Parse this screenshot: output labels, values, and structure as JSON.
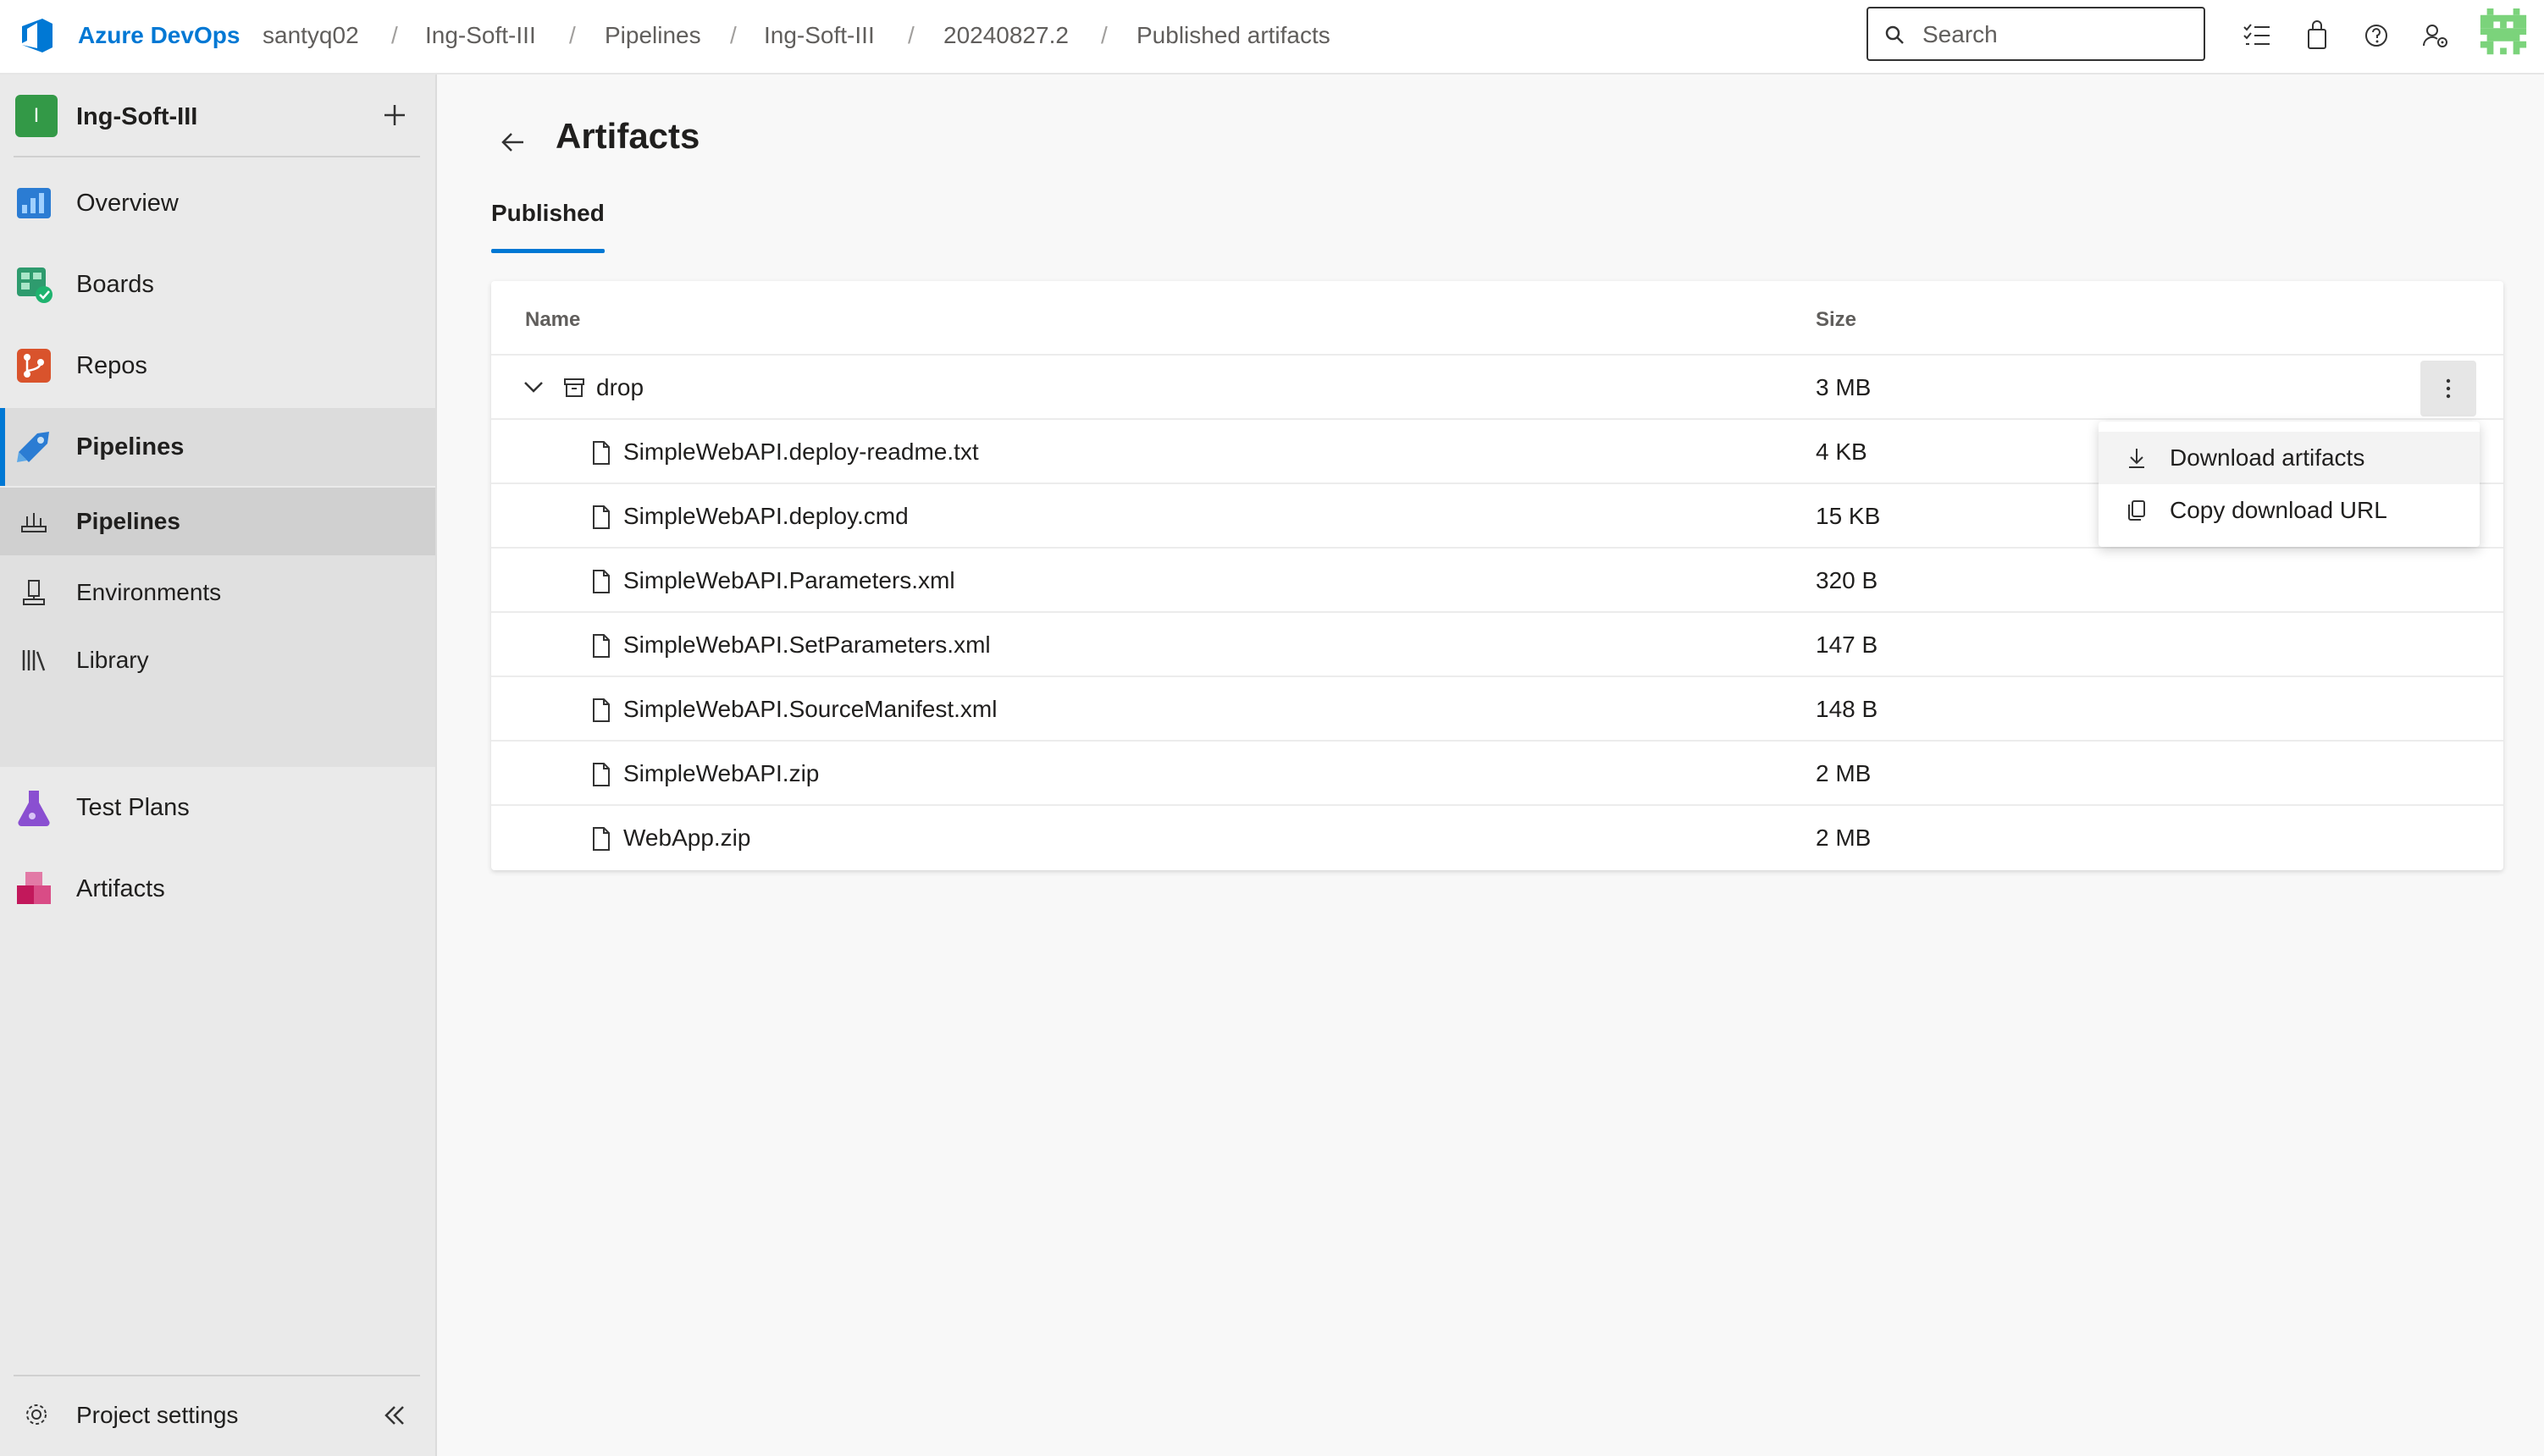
{
  "header": {
    "brand": "Azure DevOps",
    "breadcrumb": [
      "santyq02",
      "Ing-Soft-III",
      "Pipelines",
      "Ing-Soft-III",
      "20240827.2",
      "Published artifacts"
    ],
    "search_placeholder": "Search"
  },
  "sidebar": {
    "project_initial": "I",
    "project_name": "Ing-Soft-III",
    "items": [
      {
        "label": "Overview",
        "icon": "overview-icon"
      },
      {
        "label": "Boards",
        "icon": "boards-icon"
      },
      {
        "label": "Repos",
        "icon": "repos-icon"
      },
      {
        "label": "Pipelines",
        "icon": "pipelines-icon"
      },
      {
        "label": "Test Plans",
        "icon": "test-plans-icon"
      },
      {
        "label": "Artifacts",
        "icon": "artifacts-icon"
      }
    ],
    "pipelines_sub": [
      {
        "label": "Pipelines",
        "icon": "pipelines-sub-icon"
      },
      {
        "label": "Environments",
        "icon": "environments-icon"
      },
      {
        "label": "Library",
        "icon": "library-icon"
      }
    ],
    "settings_label": "Project settings"
  },
  "main": {
    "title": "Artifacts",
    "tab": "Published",
    "columns": {
      "name": "Name",
      "size": "Size"
    },
    "folder": {
      "name": "drop",
      "size": "3 MB"
    },
    "files": [
      {
        "name": "SimpleWebAPI.deploy-readme.txt",
        "size": "4 KB"
      },
      {
        "name": "SimpleWebAPI.deploy.cmd",
        "size": "15 KB"
      },
      {
        "name": "SimpleWebAPI.Parameters.xml",
        "size": "320 B"
      },
      {
        "name": "SimpleWebAPI.SetParameters.xml",
        "size": "147 B"
      },
      {
        "name": "SimpleWebAPI.SourceManifest.xml",
        "size": "148 B"
      },
      {
        "name": "SimpleWebAPI.zip",
        "size": "2 MB"
      },
      {
        "name": "WebApp.zip",
        "size": "2 MB"
      }
    ]
  },
  "context_menu": {
    "items": [
      {
        "label": "Download artifacts",
        "icon": "download-icon"
      },
      {
        "label": "Copy download URL",
        "icon": "copy-icon"
      }
    ]
  },
  "colors": {
    "accent": "#0078d4",
    "project_badge": "#339947"
  }
}
